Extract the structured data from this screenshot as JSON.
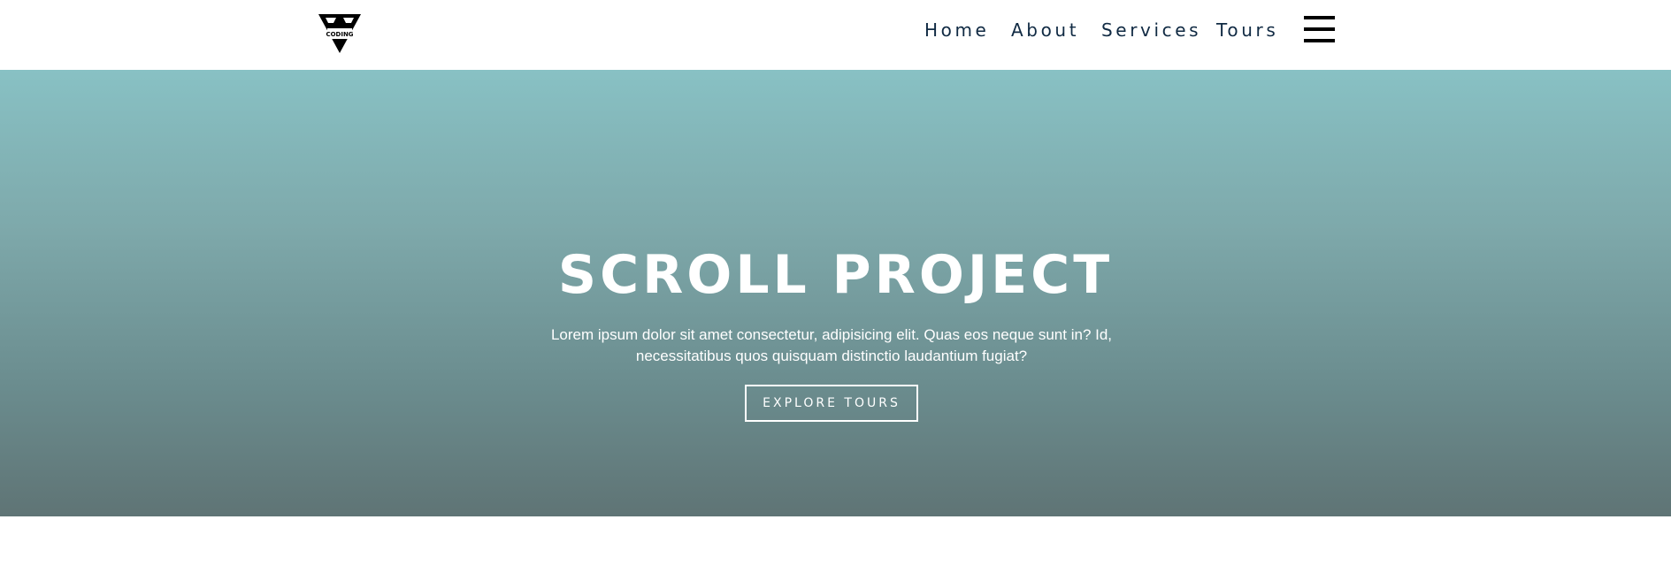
{
  "nav": {
    "logo_icon": "coding-addict-logo",
    "logo_text": "CODING",
    "links": [
      {
        "label": "Home"
      },
      {
        "label": "About"
      },
      {
        "label": "Services"
      },
      {
        "label": "Tours"
      }
    ],
    "menu_icon": "hamburger-menu-icon"
  },
  "hero": {
    "title": "SCROLL PROJECT",
    "text": "Lorem ipsum dolor sit amet consectetur, adipisicing elit. Quas eos neque sunt in? Id, necessitatibus quos quisquam distinctio laudantium fugiat?",
    "button_label": "EXPLORE TOURS",
    "gradient_top": "#88c1c4",
    "gradient_bottom": "#5f7475"
  }
}
